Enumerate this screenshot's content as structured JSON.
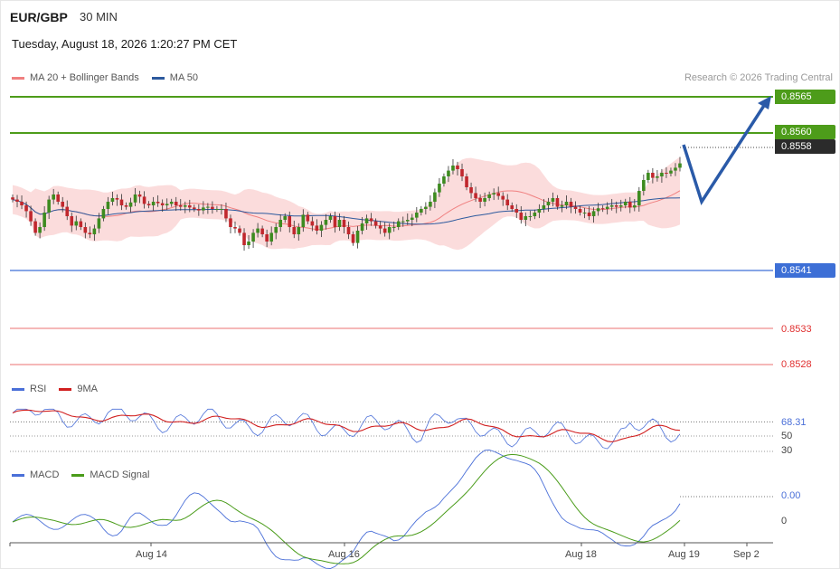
{
  "header": {
    "symbol": "EUR/GBP",
    "timeframe": "30 MIN",
    "datetime": "Tuesday, August 18, 2026 1:20:27 PM CET"
  },
  "legend": {
    "ma20_label": "MA 20 + Bollinger Bands",
    "ma50_label": "MA 50",
    "research": "Research © 2026 Trading Central"
  },
  "price_levels": {
    "target": "0.8565",
    "resistance": "0.8560",
    "current": "0.8558",
    "support": "0.8541",
    "support2": "0.8533",
    "support3": "0.8528"
  },
  "rsi": {
    "rsi_label": "RSI",
    "ma_label": "9MA",
    "value": "68.31",
    "level_50": "50",
    "level_30": "30"
  },
  "macd": {
    "macd_label": "MACD",
    "signal_label": "MACD Signal",
    "value": "0.00",
    "zero": "0"
  },
  "x_axis": [
    "Aug 14",
    "Aug 16",
    "Aug 18",
    "Aug 19",
    "Sep 2"
  ],
  "colors": {
    "green_level": "#4d9c1a",
    "blue_level": "#3d6fd6",
    "red_level": "#e03030",
    "candle_up": "#3d8b20",
    "candle_down": "#c0272d",
    "band_fill": "#fbdcdc",
    "ma20": "#f08080",
    "ma50": "#2d5a9e",
    "rsi_line": "#4a6fd8",
    "rsi_ma": "#d12020",
    "macd_line": "#4a6fd8",
    "signal_line": "#4a9c1a",
    "forecast_arrow": "#2a5aa8"
  },
  "chart_data": {
    "type": "candlestick",
    "title": "EUR/GBP 30 MIN",
    "y_range": [
      0.8526,
      0.8567
    ],
    "x_categories": [
      "Aug 14",
      "Aug 16",
      "Aug 18",
      "Aug 19",
      "Sep 2"
    ],
    "series": [
      {
        "name": "MA 20 + Bollinger Bands",
        "type": "line+band"
      },
      {
        "name": "MA 50",
        "type": "line"
      }
    ],
    "closes": [
      0.85508,
      0.85505,
      0.855,
      0.85492,
      0.85478,
      0.85462,
      0.8547,
      0.8549,
      0.85508,
      0.85515,
      0.85505,
      0.85498,
      0.85485,
      0.85472,
      0.85478,
      0.8547,
      0.85462,
      0.8546,
      0.85468,
      0.85482,
      0.85495,
      0.85505,
      0.8551,
      0.85508,
      0.855,
      0.85498,
      0.85504,
      0.85515,
      0.85512,
      0.85502,
      0.855,
      0.85505,
      0.85503,
      0.855,
      0.85502,
      0.85505,
      0.855,
      0.85498,
      0.855,
      0.85497,
      0.85495,
      0.85493,
      0.85497,
      0.85498,
      0.85495,
      0.85495,
      0.85495,
      0.85482,
      0.8547,
      0.85468,
      0.85462,
      0.85445,
      0.8545,
      0.85462,
      0.85468,
      0.8546,
      0.8545,
      0.85462,
      0.8547,
      0.8548,
      0.85485,
      0.8547,
      0.8546,
      0.8547,
      0.85487,
      0.85478,
      0.85472,
      0.85465,
      0.85473,
      0.8548,
      0.85485,
      0.8547,
      0.8548,
      0.8547,
      0.8546,
      0.85448,
      0.85465,
      0.85475,
      0.85482,
      0.85478,
      0.85472,
      0.85468,
      0.85462,
      0.8547,
      0.8547,
      0.85478,
      0.85478,
      0.8548,
      0.85483,
      0.8549,
      0.85495,
      0.85498,
      0.85505,
      0.85518,
      0.8553,
      0.8554,
      0.85548,
      0.85555,
      0.8555,
      0.8554,
      0.85525,
      0.85517,
      0.8551,
      0.85505,
      0.8551,
      0.85515,
      0.85517,
      0.85513,
      0.85508,
      0.855,
      0.85495,
      0.8549,
      0.8548,
      0.85485,
      0.85485,
      0.8549,
      0.85495,
      0.855,
      0.85505,
      0.8551,
      0.85498,
      0.855,
      0.85505,
      0.85498,
      0.85495,
      0.8549,
      0.8549,
      0.85485,
      0.85492,
      0.85496,
      0.85495,
      0.85498,
      0.855,
      0.85498,
      0.855,
      0.85505,
      0.85497,
      0.855,
      0.8552,
      0.85535,
      0.85545,
      0.85538,
      0.8554,
      0.85545,
      0.85544,
      0.85548,
      0.85552,
      0.85558
    ],
    "rsi": {
      "value": 68.31,
      "levels": [
        50,
        30
      ],
      "series": [
        "RSI",
        "9MA"
      ]
    },
    "macd": {
      "value": 0.0,
      "series": [
        "MACD",
        "MACD Signal"
      ]
    },
    "levels": [
      0.8565,
      0.856,
      0.8558,
      0.8541,
      0.8533,
      0.8528
    ]
  }
}
